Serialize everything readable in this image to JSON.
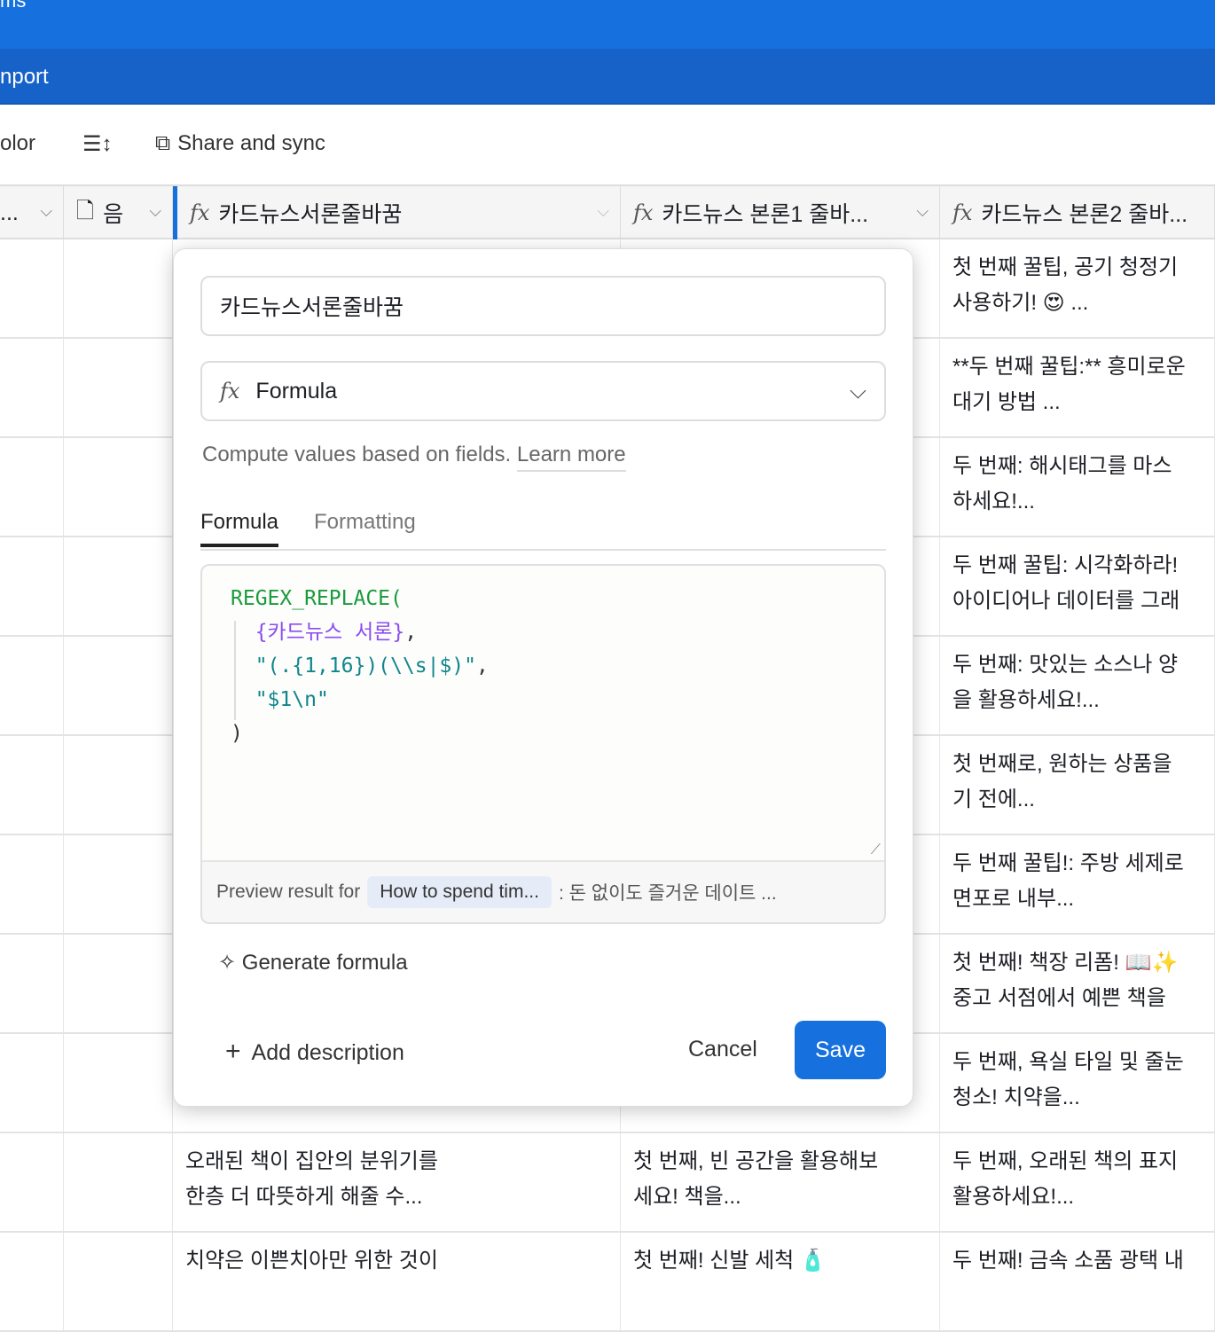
{
  "top_bar": {
    "label": "ms"
  },
  "nav_bar": {
    "label": "nport"
  },
  "toolbar": {
    "color_label": "olor",
    "share_label": "Share and sync"
  },
  "header": {
    "col0": "...",
    "col1": "음",
    "col2": "카드뉴스서론줄바꿈",
    "col3": "카드뉴스 본론1 줄바...",
    "col4": "카드뉴스 본론2 줄바..."
  },
  "rows": [
    {
      "c2": "",
      "c3": "",
      "c4": "첫 번째 꿀팁, 공기 청정기\n사용하기! 😍 ..."
    },
    {
      "c2": "",
      "c3": "",
      "c4": "**두 번째 꿀팁:** 흥미로운\n대기 방법 ..."
    },
    {
      "c2": "",
      "c3": "",
      "c4": "두 번째: 해시태그를 마스\n하세요!..."
    },
    {
      "c2": "",
      "c3": "",
      "c4": "두 번째 꿀팁: 시각화하라!\n아이디어나 데이터를 그래"
    },
    {
      "c2": "",
      "c3": "",
      "c4": "두 번째: 맛있는 소스나 양\n을 활용하세요!..."
    },
    {
      "c2": "",
      "c3": "",
      "c4": "첫 번째로, 원하는 상품을\n기 전에..."
    },
    {
      "c2": "",
      "c3": "",
      "c4": "두 번째 꿀팁!: 주방 세제로\n면포로 내부..."
    },
    {
      "c2": "",
      "c3": "",
      "c4": "첫 번째! 책장 리폼! 📖✨\n중고 서점에서 예쁜 책을"
    },
    {
      "c2": "",
      "c3": "",
      "c4": "두 번째, 욕실 타일 및 줄눈\n청소! 치약을..."
    },
    {
      "c2": "오래된 책이 집안의 분위기를\n한층 더 따뜻하게 해줄 수...",
      "c3": "첫 번째, 빈 공간을 활용해보\n세요! 책을...",
      "c4": "두 번째, 오래된 책의 표지\n활용하세요!..."
    },
    {
      "c2": "치약은 이쁜치아만 위한 것이",
      "c3": "첫 번째! 신발 세척 🧴",
      "c4": "두 번째! 금속 소품 광택 내"
    }
  ],
  "popup": {
    "name_value": "카드뉴스서론줄바꿈",
    "type_value": "Formula",
    "help_text": "Compute values based on fields.",
    "learn_more": "Learn more",
    "tabs": [
      "Formula",
      "Formatting"
    ],
    "code": {
      "fn": "REGEX_REPLACE(",
      "field": "{카드뉴스 서론}",
      "arg2": "\"(.{1,16})(\\\\s|$)\"",
      "arg3": "\"$1\\n\"",
      "close": ")",
      "comma": ","
    },
    "preview_label": "Preview result for",
    "preview_record": "How to spend tim...",
    "preview_value": ": 돈 없이도 즐거운 데이트 ...",
    "generate": "Generate formula",
    "add_description": "Add description",
    "cancel": "Cancel",
    "save": "Save"
  }
}
